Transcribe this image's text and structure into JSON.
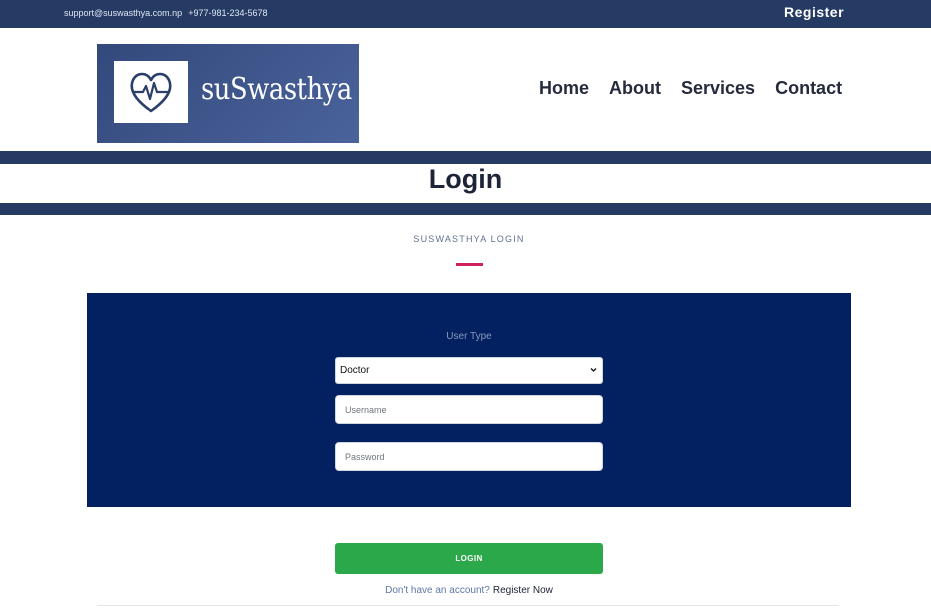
{
  "topbar": {
    "email": "support@suswasthya.com.np",
    "phone": "+977-981-234-5678",
    "register_label": "Register"
  },
  "brand": {
    "name": "suSwasthya",
    "icon": "heart-pulse-icon"
  },
  "nav": {
    "items": [
      "Home",
      "About",
      "Services",
      "Contact"
    ]
  },
  "page": {
    "title": "Login",
    "section_label": "SUSWASTHYA LOGIN"
  },
  "form": {
    "user_type_label": "User Type",
    "user_type_value": "Doctor",
    "username_placeholder": "Username",
    "password_placeholder": "Password",
    "login_label": "LOGIN",
    "no_account_text": "Don't have an account?",
    "register_now_label": "Register Now"
  },
  "colors": {
    "navy": "#253b64",
    "panel": "#032061",
    "accent": "#d01f5e",
    "button": "#2ba84a"
  }
}
